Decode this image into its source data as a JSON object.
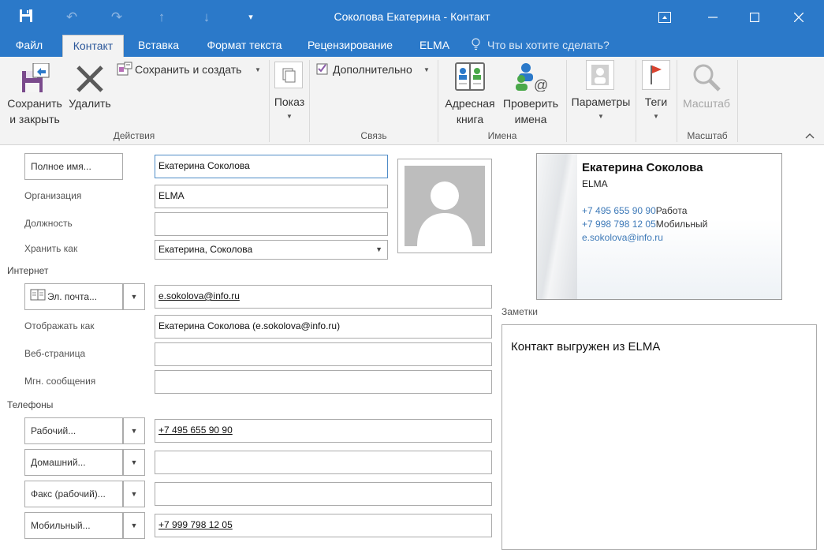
{
  "window": {
    "title": "Соколова Екатерина - Контакт"
  },
  "tabs": [
    {
      "label": "Файл"
    },
    {
      "label": "Контакт"
    },
    {
      "label": "Вставка"
    },
    {
      "label": "Формат текста"
    },
    {
      "label": "Рецензирование"
    },
    {
      "label": "ELMA"
    }
  ],
  "tell_me": {
    "placeholder": "Что вы хотите сделать?"
  },
  "ribbon": {
    "groups": {
      "actions": "Действия",
      "connect": "Связь",
      "names": "Имена",
      "zoom": "Масштаб"
    },
    "save_close": {
      "line1": "Сохранить",
      "line2": "и закрыть"
    },
    "delete": "Удалить",
    "save_new": "Сохранить и создать",
    "show": "Показ",
    "more": "Дополнительно",
    "address_book": {
      "line1": "Адресная",
      "line2": "книга"
    },
    "check_names": {
      "line1": "Проверить",
      "line2": "имена"
    },
    "options": "Параметры",
    "tags": "Теги",
    "zoom_button": "Масштаб"
  },
  "form": {
    "full_name_button": "Полное имя...",
    "full_name": "Екатерина Соколова",
    "company_label": "Организация",
    "company": "ELMA",
    "job_title_label": "Должность",
    "job_title": "",
    "file_as_label": "Хранить как",
    "file_as": "Екатерина, Соколова",
    "internet_section": "Интернет",
    "email_button": "Эл. почта...",
    "email": "e.sokolova@info.ru",
    "display_as_label": "Отображать как",
    "display_as": "Екатерина Соколова (e.sokolova@info.ru)",
    "web_page_label": "Веб-страница",
    "web_page": "",
    "im_label": "Мгн. сообщения",
    "im": "",
    "phones_section": "Телефоны",
    "phone_work_button": "Рабочий...",
    "phone_work": "+7 495 655 90 90",
    "phone_home_button": "Домашний...",
    "phone_home": "",
    "fax_button": "Факс (рабочий)...",
    "fax": "",
    "mobile_button": "Мобильный...",
    "mobile": "+7 999 798 12 05"
  },
  "card": {
    "name": "Екатерина Соколова",
    "org": "ELMA",
    "phone1": "+7 495 655 90 90",
    "phone1_type": "Работа",
    "phone2": "+7 998 798 12 05",
    "phone2_type": "Мобильный",
    "email": "e.sokolova@info.ru"
  },
  "notes": {
    "label": "Заметки",
    "text": "Контакт выгружен из ELMA"
  },
  "colors": {
    "accent": "#2b79c9",
    "ribbon_bg": "#f3f3f3",
    "link": "#3e7ab8"
  }
}
